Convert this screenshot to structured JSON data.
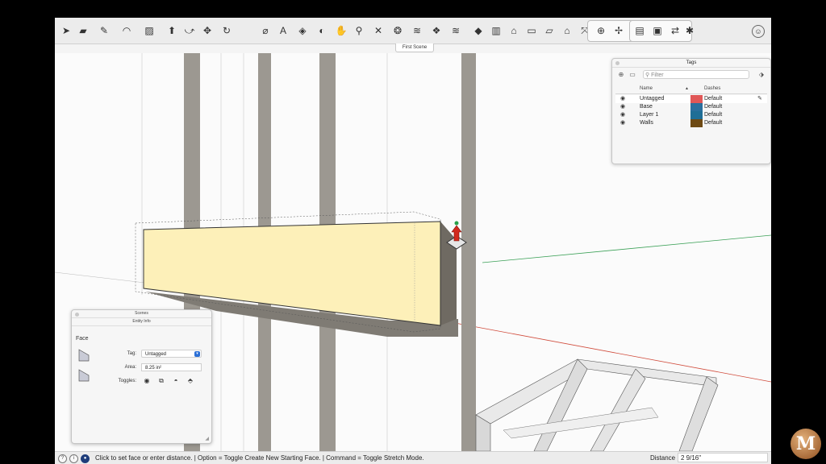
{
  "toolbar": {
    "tools": [
      {
        "icon": "select-arrow-icon",
        "glyph": "➤"
      },
      {
        "icon": "eraser-icon",
        "glyph": "▰"
      },
      {
        "icon": "pencil-line-icon",
        "glyph": "✎"
      },
      {
        "icon": "arc-icon",
        "glyph": "◠"
      },
      {
        "icon": "rectangle-icon",
        "glyph": "▨"
      },
      {
        "icon": "push-pull-icon",
        "glyph": "⬆"
      },
      {
        "icon": "follow-me-icon",
        "glyph": "⤻"
      },
      {
        "icon": "move-icon",
        "glyph": "✥"
      },
      {
        "icon": "rotate-icon",
        "glyph": "↻"
      },
      {
        "icon": "tape-measure-icon",
        "glyph": "⌀"
      },
      {
        "icon": "text-label-icon",
        "glyph": "A"
      },
      {
        "icon": "paint-bucket-icon",
        "glyph": "◈"
      },
      {
        "icon": "orbit-icon",
        "glyph": "◐"
      },
      {
        "icon": "pan-icon",
        "glyph": "✋"
      },
      {
        "icon": "zoom-icon",
        "glyph": "⚲"
      },
      {
        "icon": "zoom-extents-icon",
        "glyph": "✕"
      },
      {
        "icon": "components-icon",
        "glyph": "❂"
      },
      {
        "icon": "section-plane-icon",
        "glyph": "≋"
      },
      {
        "icon": "solid-tools-icon",
        "glyph": "❖"
      },
      {
        "icon": "sandbox-icon",
        "glyph": "≋"
      },
      {
        "icon": "iso-view-icon",
        "glyph": "◆"
      },
      {
        "icon": "cylinder-view-icon",
        "glyph": "▥"
      },
      {
        "icon": "house-view-icon",
        "glyph": "⌂"
      },
      {
        "icon": "front-view-icon",
        "glyph": "▭"
      },
      {
        "icon": "side-view-icon",
        "glyph": "▱"
      },
      {
        "icon": "back-view-icon",
        "glyph": "⌂"
      },
      {
        "icon": "axes-icon",
        "glyph": "⤧"
      }
    ],
    "group_tools": [
      {
        "icon": "position-camera-icon",
        "glyph": "⊕"
      },
      {
        "icon": "walk-icon",
        "glyph": "✢"
      },
      {
        "icon": "scene-manager-icon",
        "glyph": "▤"
      },
      {
        "icon": "display-settings-icon",
        "glyph": "▣"
      },
      {
        "icon": "transfer-icon",
        "glyph": "⇄"
      },
      {
        "icon": "extension-icon",
        "glyph": "✱"
      }
    ],
    "account_icon": "user-account-icon"
  },
  "scene_tab": {
    "label": "First Scene"
  },
  "tags_panel": {
    "title": "Tags",
    "filter_placeholder": "Filter",
    "header_name": "Name",
    "header_dashes": "Dashes",
    "rows": [
      {
        "name": "Untagged",
        "color": "#e05757",
        "dashes": "Default"
      },
      {
        "name": "Base",
        "color": "#2a6f9e",
        "dashes": "Default"
      },
      {
        "name": "Layer 1",
        "color": "#1f6e96",
        "dashes": "Default"
      },
      {
        "name": "Walls",
        "color": "#6e4a14",
        "dashes": "Default"
      }
    ]
  },
  "entity_panel": {
    "scenes_title": "Scenes",
    "title": "Entity Info",
    "entity_type": "Face",
    "tag_label": "Tag:",
    "tag_value": "Untagged",
    "area_label": "Area:",
    "area_value": "8.25 in²",
    "toggles_label": "Toggles:"
  },
  "status": {
    "message": "Click to set face or enter distance. | Option = Toggle Create New Starting Face. | Command = Toggle Stretch Mode.",
    "distance_label": "Distance",
    "distance_value": "2 9/16\""
  },
  "colors": {
    "face_fill": "#fdf0b9",
    "stud": "#9a968f",
    "red_axis": "#d04a3a",
    "green_axis": "#3aa056"
  },
  "logo": {
    "letter": "M"
  }
}
